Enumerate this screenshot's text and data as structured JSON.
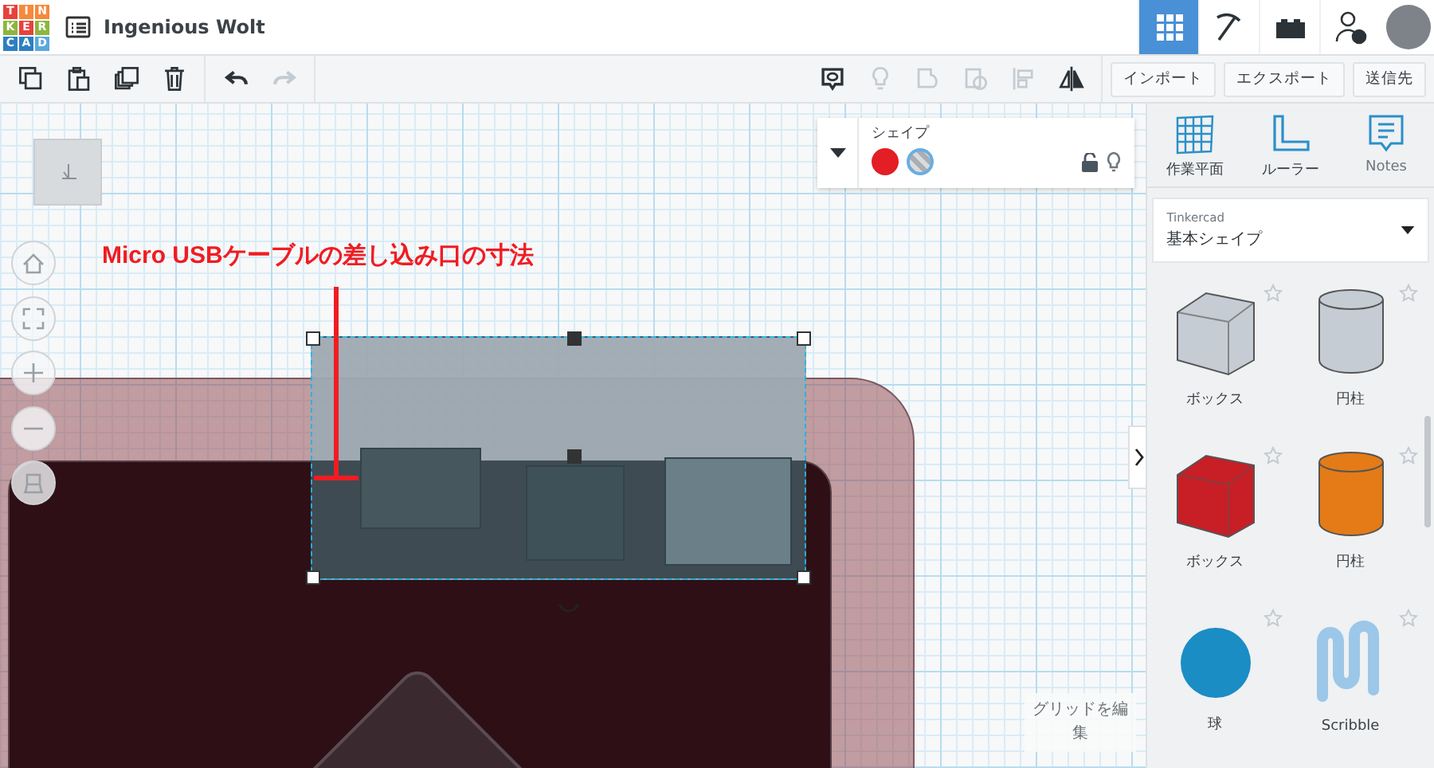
{
  "logo": {
    "tiles": [
      {
        "letter": "T",
        "color": "#e8413c"
      },
      {
        "letter": "I",
        "color": "#f6893b"
      },
      {
        "letter": "N",
        "color": "#f6893b"
      },
      {
        "letter": "K",
        "color": "#8cb63c"
      },
      {
        "letter": "E",
        "color": "#e8413c"
      },
      {
        "letter": "R",
        "color": "#8cb63c"
      },
      {
        "letter": "C",
        "color": "#2d7fc1"
      },
      {
        "letter": "A",
        "color": "#2d7fc1"
      },
      {
        "letter": "D",
        "color": "#5aa9dd"
      }
    ]
  },
  "project": {
    "title": "Ingenious Wolt"
  },
  "view_modes": [
    {
      "kind": "grid",
      "selected": true
    },
    {
      "kind": "pickaxe",
      "selected": false
    },
    {
      "kind": "bricks",
      "selected": false
    }
  ],
  "toolbar": {
    "edit_tools": [
      {
        "kind": "copy",
        "disabled": false
      },
      {
        "kind": "paste",
        "disabled": false
      },
      {
        "kind": "duplicate",
        "disabled": false
      },
      {
        "kind": "delete",
        "disabled": false
      }
    ],
    "history_tools": [
      {
        "kind": "undo",
        "disabled": false
      },
      {
        "kind": "redo",
        "disabled": true
      }
    ],
    "view_tools": [
      {
        "kind": "notes",
        "disabled": false
      },
      {
        "kind": "bulb",
        "disabled": true
      },
      {
        "kind": "group",
        "disabled": true
      },
      {
        "kind": "ungroup",
        "disabled": true
      },
      {
        "kind": "align",
        "disabled": true
      },
      {
        "kind": "mirror",
        "disabled": false
      }
    ],
    "buttons": [
      "インポート",
      "エクスポート",
      "送信先"
    ]
  },
  "shape_panel": {
    "title": "シェイプ",
    "fills": [
      {
        "kind": "solid",
        "color": "#e31e24",
        "selected": false
      },
      {
        "kind": "hole",
        "color": "#a9aeb3",
        "selected": true
      }
    ]
  },
  "canvas": {
    "annotation": "Micro USBケーブルの差し込み口の寸法",
    "grid_button": "グリッドを編集"
  },
  "tools": [
    "作業平面",
    "ルーラー",
    "Notes"
  ],
  "library": {
    "label": "Tinkercad",
    "value": "基本シェイプ"
  },
  "shapes": [
    {
      "kind": "box",
      "name": "ボックス",
      "color": "#c5ccd3"
    },
    {
      "kind": "cylinder",
      "name": "円柱",
      "color": "#c5ccd3"
    },
    {
      "kind": "box",
      "name": "ボックス",
      "color": "#c81e25"
    },
    {
      "kind": "cylinder",
      "name": "円柱",
      "color": "#e47b16"
    },
    {
      "kind": "sphere",
      "name": "球",
      "color": "#1a8dc4"
    },
    {
      "kind": "scribble",
      "name": "Scribble",
      "color": "#9cc7e8"
    }
  ]
}
